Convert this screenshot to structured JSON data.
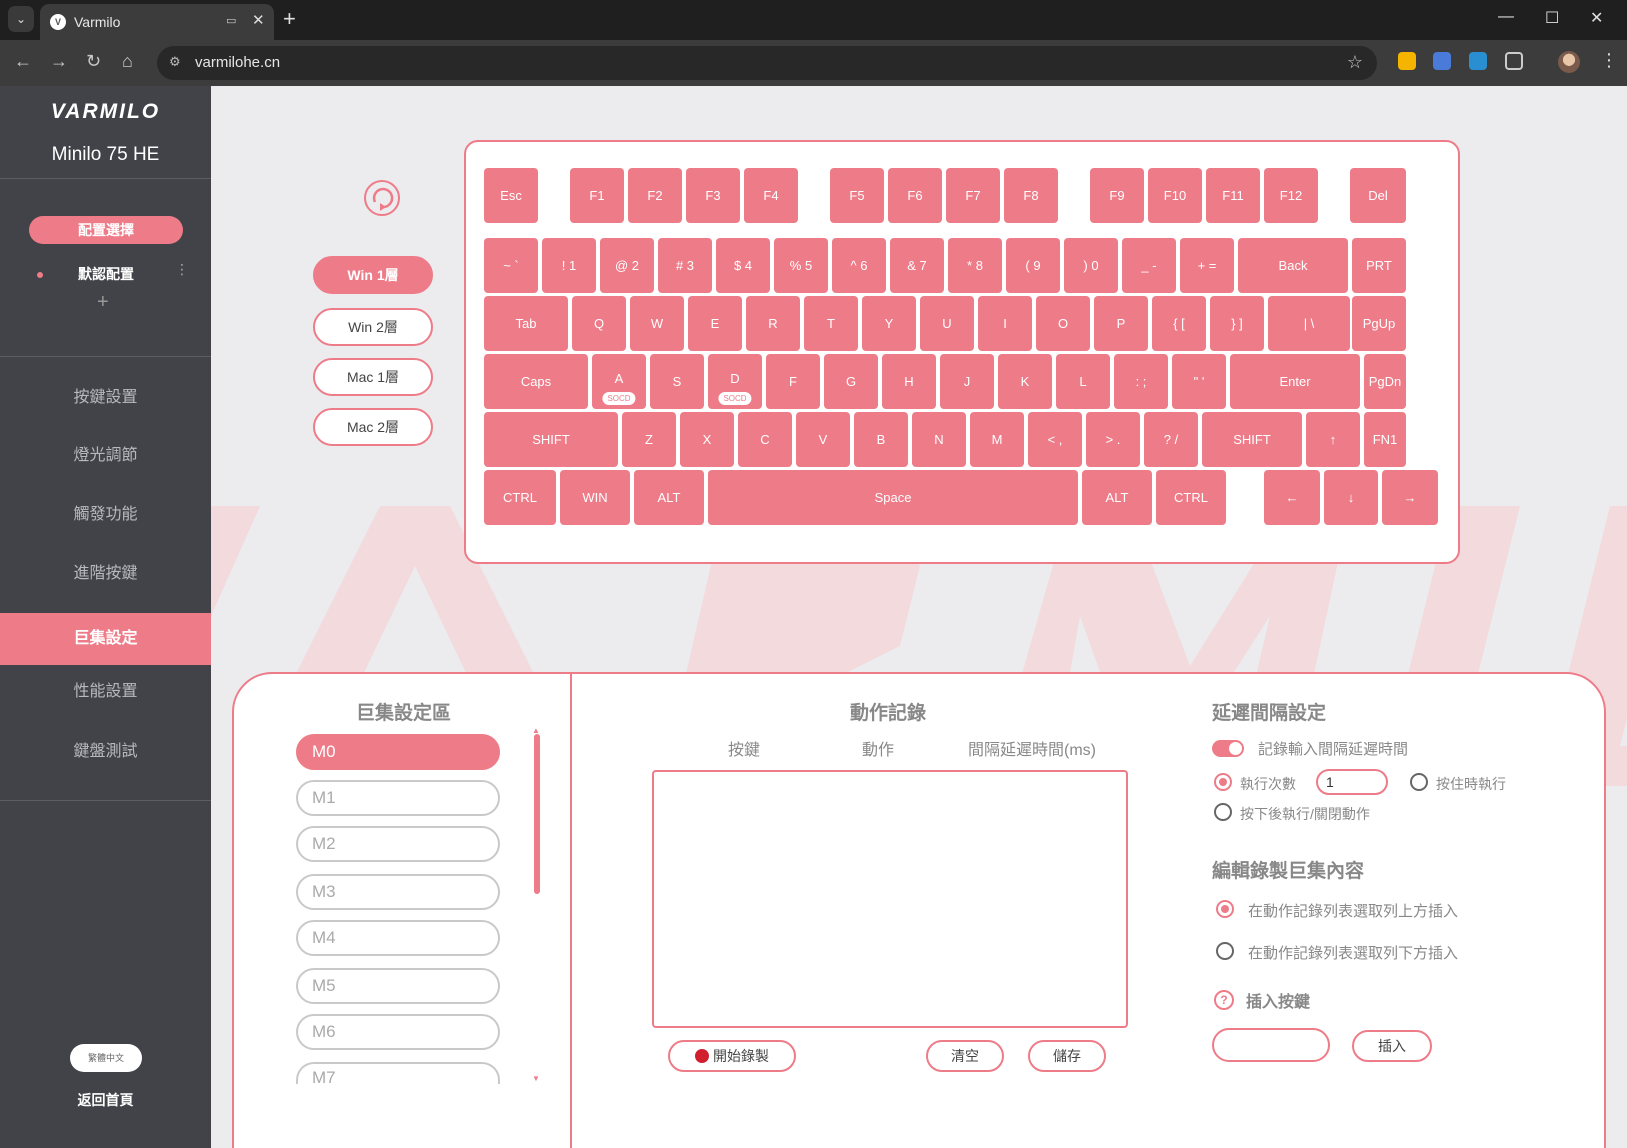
{
  "browser": {
    "tab_title": "Varmilo",
    "url": "varmilohe.cn",
    "new_tab": "+",
    "tab_close": "✕",
    "minimize": "—",
    "maximize": "☐",
    "close": "✕"
  },
  "sidebar": {
    "brand": "VARMILO",
    "model": "Minilo 75 HE",
    "config_select": "配置選擇",
    "config_default": "默認配置",
    "add": "+",
    "menu": [
      {
        "label": "按鍵設置",
        "active": false
      },
      {
        "label": "燈光調節",
        "active": false
      },
      {
        "label": "觸發功能",
        "active": false
      },
      {
        "label": "進階按鍵",
        "active": false
      },
      {
        "label": "巨集設定",
        "active": true
      },
      {
        "label": "性能設置",
        "active": false
      },
      {
        "label": "鍵盤測試",
        "active": false
      }
    ],
    "language": "繁體中文",
    "back_home": "返回首頁"
  },
  "layers": [
    {
      "label": "Win 1層",
      "active": true
    },
    {
      "label": "Win 2層",
      "active": false
    },
    {
      "label": "Mac 1層",
      "active": false
    },
    {
      "label": "Mac 2層",
      "active": false
    }
  ],
  "keyboard": {
    "rows": [
      [
        "Esc",
        "F1",
        "F2",
        "F3",
        "F4",
        "F5",
        "F6",
        "F7",
        "F8",
        "F9",
        "F10",
        "F11",
        "F12",
        "Del"
      ],
      [
        "~ `",
        "! 1",
        "@ 2",
        "# 3",
        "$ 4",
        "% 5",
        "^ 6",
        "& 7",
        "* 8",
        "( 9",
        ") 0",
        "_ -",
        "+ =",
        "Back",
        "PRT"
      ],
      [
        "Tab",
        "Q",
        "W",
        "E",
        "R",
        "T",
        "Y",
        "U",
        "I",
        "O",
        "P",
        "{ [",
        "} ]",
        "| \\",
        "PgUp"
      ],
      [
        "Caps",
        "A",
        "S",
        "D",
        "F",
        "G",
        "H",
        "J",
        "K",
        "L",
        ": ;",
        "\" '",
        "Enter",
        "PgDn"
      ],
      [
        "SHIFT",
        "Z",
        "X",
        "C",
        "V",
        "B",
        "N",
        "M",
        "< ,",
        "> .",
        "? /",
        "SHIFT",
        "↑",
        "FN1"
      ],
      [
        "CTRL",
        "WIN",
        "ALT",
        "Space",
        "ALT",
        "CTRL",
        "←",
        "↓",
        "→"
      ]
    ],
    "socd_badge": "SOCD",
    "socd_keys": [
      "A",
      "D"
    ]
  },
  "macro": {
    "title": "巨集設定區",
    "slots": [
      {
        "label": "M0",
        "active": true
      },
      {
        "label": "M1",
        "active": false
      },
      {
        "label": "M2",
        "active": false
      },
      {
        "label": "M3",
        "active": false
      },
      {
        "label": "M4",
        "active": false
      },
      {
        "label": "M5",
        "active": false
      },
      {
        "label": "M6",
        "active": false
      },
      {
        "label": "M7",
        "active": false
      }
    ]
  },
  "record": {
    "title": "動作記錄",
    "col_key": "按鍵",
    "col_action": "動作",
    "col_delay": "間隔延遲時間(ms)",
    "start_btn": "開始錄製",
    "clear_btn": "清空",
    "save_btn": "儲存"
  },
  "delay": {
    "title": "延遲間隔設定",
    "record_delay_label": "記錄輸入間隔延遲時間",
    "exec_count_label": "執行次數",
    "exec_count_value": "1",
    "hold_exec_label": "按住時執行",
    "toggle_exec_label": "按下後執行/關閉動作"
  },
  "edit": {
    "title": "編輯錄製巨集內容",
    "insert_above": "在動作記錄列表選取列上方插入",
    "insert_below": "在動作記錄列表選取列下方插入",
    "insert_key_label": "插入按鍵",
    "insert_btn": "插入"
  },
  "colors": {
    "accent": "#ee7b88",
    "sidebar": "#424349",
    "background": "#ececef"
  }
}
